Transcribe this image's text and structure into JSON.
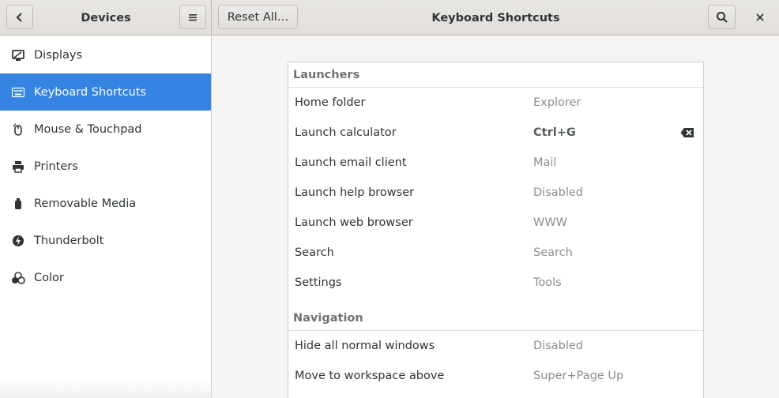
{
  "header": {
    "devices_title": "Devices",
    "reset_label": "Reset All…",
    "window_title": "Keyboard Shortcuts"
  },
  "sidebar": {
    "items": [
      {
        "label": "Displays",
        "icon": "display-icon",
        "active": false
      },
      {
        "label": "Keyboard Shortcuts",
        "icon": "keyboard-icon",
        "active": true
      },
      {
        "label": "Mouse & Touchpad",
        "icon": "mouse-icon",
        "active": false
      },
      {
        "label": "Printers",
        "icon": "printer-icon",
        "active": false
      },
      {
        "label": "Removable Media",
        "icon": "usb-drive-icon",
        "active": false
      },
      {
        "label": "Thunderbolt",
        "icon": "thunderbolt-icon",
        "active": false
      },
      {
        "label": "Color",
        "icon": "color-icon",
        "active": false
      }
    ]
  },
  "shortcuts": {
    "sections": [
      {
        "title": "Launchers",
        "rows": [
          {
            "label": "Home folder",
            "accel": "Explorer"
          },
          {
            "label": "Launch calculator",
            "accel": "Ctrl+G",
            "edited": true
          },
          {
            "label": "Launch email client",
            "accel": "Mail"
          },
          {
            "label": "Launch help browser",
            "accel": "Disabled"
          },
          {
            "label": "Launch web browser",
            "accel": "WWW"
          },
          {
            "label": "Search",
            "accel": "Search"
          },
          {
            "label": "Settings",
            "accel": "Tools"
          }
        ]
      },
      {
        "title": "Navigation",
        "rows": [
          {
            "label": "Hide all normal windows",
            "accel": "Disabled"
          },
          {
            "label": "Move to workspace above",
            "accel": "Super+Page Up"
          }
        ]
      }
    ]
  },
  "colors": {
    "accent": "#3584e4",
    "sidebar_bg": "#ffffff",
    "window_bg": "#f6f5f4"
  }
}
